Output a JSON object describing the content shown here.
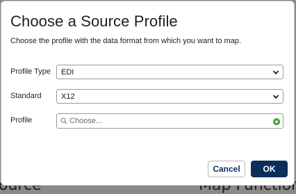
{
  "backdrop": {
    "left_text": "ource",
    "right_text": "Map Function"
  },
  "dialog": {
    "title": "Choose a Source Profile",
    "subtitle": "Choose the profile with the data format from which you want to map.",
    "fields": {
      "profile_type": {
        "label": "Profile Type",
        "value": "EDI"
      },
      "standard": {
        "label": "Standard",
        "value": "X12"
      },
      "profile": {
        "label": "Profile",
        "placeholder": "Choose..."
      }
    },
    "buttons": {
      "cancel": "Cancel",
      "ok": "OK"
    },
    "colors": {
      "primary": "#0b2f5a",
      "add_icon": "#3c9a2e"
    },
    "icons": {
      "select_chevron": "chevron-down-icon",
      "lookup_search": "search-icon",
      "lookup_add": "add-icon"
    }
  }
}
